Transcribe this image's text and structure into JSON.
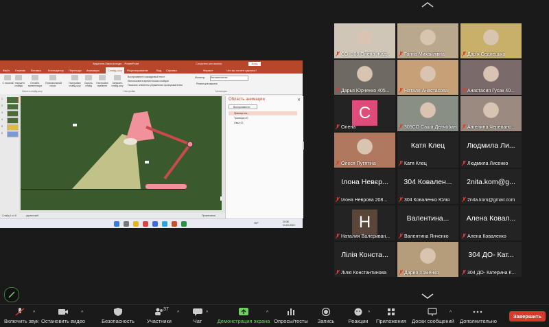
{
  "shared_screen": {
    "ppt": {
      "title": "Закупочн.Ламп.исходн. - PowerPoint",
      "title_extra": "Средства рисования",
      "login_button": "Вход",
      "tabs": [
        "Файл",
        "Главная",
        "Вставка",
        "Конструктор",
        "Переходы",
        "Анимация",
        "Слайд-шоу",
        "Рецензирование",
        "Вид",
        "Справка",
        "Формат",
        "Что вы хотите сделать?"
      ],
      "active_tab": "Слайд-шоу",
      "ribbon": {
        "from_start": "С начала",
        "from_current": "С текущего слайда",
        "online": "Онлайн-презентация",
        "custom": "Произвольный показ",
        "setup": "Настройка слайд-шоу",
        "hide": "Скрыть слайд",
        "rehearse": "Настройка времени",
        "record": "Записать слайд-шоу",
        "opt1": "Воспроизвести закадровый текст",
        "opt2": "Использовать время показа слайдов",
        "opt3": "Показать элементы управления проигрывателем",
        "monitor_label": "Монитор:",
        "monitor_value": "Автоматически",
        "presenter": "Режим докладчика",
        "group_start": "Начать слайд-шоу",
        "group_setup": "Настройка",
        "group_monitors": "Мониторы"
      },
      "anim_pane": {
        "title": "Область анимации",
        "play": "Воспроизвести",
        "items": [
          "Прямоуголь...",
          "Трапеция 20",
          "Овал 22"
        ]
      },
      "status": {
        "slide": "Слайд 1 из 8",
        "lang": "украинский",
        "notes": "Примечания",
        "zoom": "+"
      },
      "clock": {
        "time": "20:38",
        "date": "24.03.2022",
        "lang": "УКР"
      }
    }
  },
  "participants": [
    {
      "name": "СО- 308 Олена Жад...",
      "display": "",
      "type": "video",
      "bg": "#cfc6b8"
    },
    {
      "name": "Ганна Михайлівна",
      "display": "",
      "type": "video",
      "bg": "#b9a88e"
    },
    {
      "name": "Дар'я Седлецька",
      "display": "",
      "type": "video",
      "bg": "#c8b06a"
    },
    {
      "name": "Дарья Юрченко 405...",
      "display": "",
      "type": "video",
      "bg": "#6e6a63"
    },
    {
      "name": "Наталя Анастасова",
      "display": "",
      "type": "video",
      "bg": "#c6a077"
    },
    {
      "name": "Анастасия Гусак 40...",
      "display": "",
      "type": "video",
      "bg": "#7b6a6a"
    },
    {
      "name": "Олена",
      "display": "",
      "type": "initial",
      "initial": "C",
      "color": "#e04c7a"
    },
    {
      "name": "305СО Саша Делчобан",
      "display": "",
      "type": "video",
      "bg": "#8a8f86",
      "active": true
    },
    {
      "name": "Ангелина Черепано...",
      "display": "",
      "type": "video",
      "bg": "#9a8a80"
    },
    {
      "name": "Олеся Путятіна",
      "display": "",
      "type": "video",
      "bg": "#b0785e"
    },
    {
      "name": "Катя Клец",
      "display": "Катя Клец",
      "type": "text"
    },
    {
      "name": "Людмила Лисенко",
      "display": "Людмила Ли...",
      "type": "text"
    },
    {
      "name": "Ілона Неврова 208...",
      "display": "Ілона Невєр...",
      "type": "text"
    },
    {
      "name": "304 Коваленко Юлія",
      "display": "304 Ковален...",
      "type": "text"
    },
    {
      "name": "2nita.kom@gmail.com",
      "display": "2nita.kom@g...",
      "type": "text"
    },
    {
      "name": "Наталия Валериван...",
      "display": "",
      "type": "initial",
      "initial": "H",
      "color": "#5a4638"
    },
    {
      "name": "Валентина Янченко",
      "display": "Валентина...",
      "type": "text"
    },
    {
      "name": "Алена Коваленко",
      "display": "Алена Ковал...",
      "type": "text"
    },
    {
      "name": "Лілія Константинова",
      "display": "Лілія Конста...",
      "type": "text"
    },
    {
      "name": "Дария Хоменко",
      "display": "",
      "type": "video",
      "bg": "#b59c7a"
    },
    {
      "name": "304 ДО- Катерина К...",
      "display": "304 ДО- Кат...",
      "type": "text"
    }
  ],
  "toolbar": {
    "mute": "Включить звук",
    "video": "Остановить видео",
    "security": "Безопасность",
    "participants": "Участники",
    "participants_count": "37",
    "chat": "Чат",
    "share": "Демонстрация экрана",
    "polls": "Опросы/тесты",
    "record": "Запись",
    "reactions": "Реакции",
    "apps": "Приложения",
    "whiteboard": "Доски сообщений",
    "more": "Дополнительно",
    "end": "Завершить"
  },
  "colors": {
    "share_green": "#6bd35c",
    "end_red": "#d53a2c",
    "ppt_accent": "#b7472a",
    "mic_red": "#e23a2e"
  }
}
